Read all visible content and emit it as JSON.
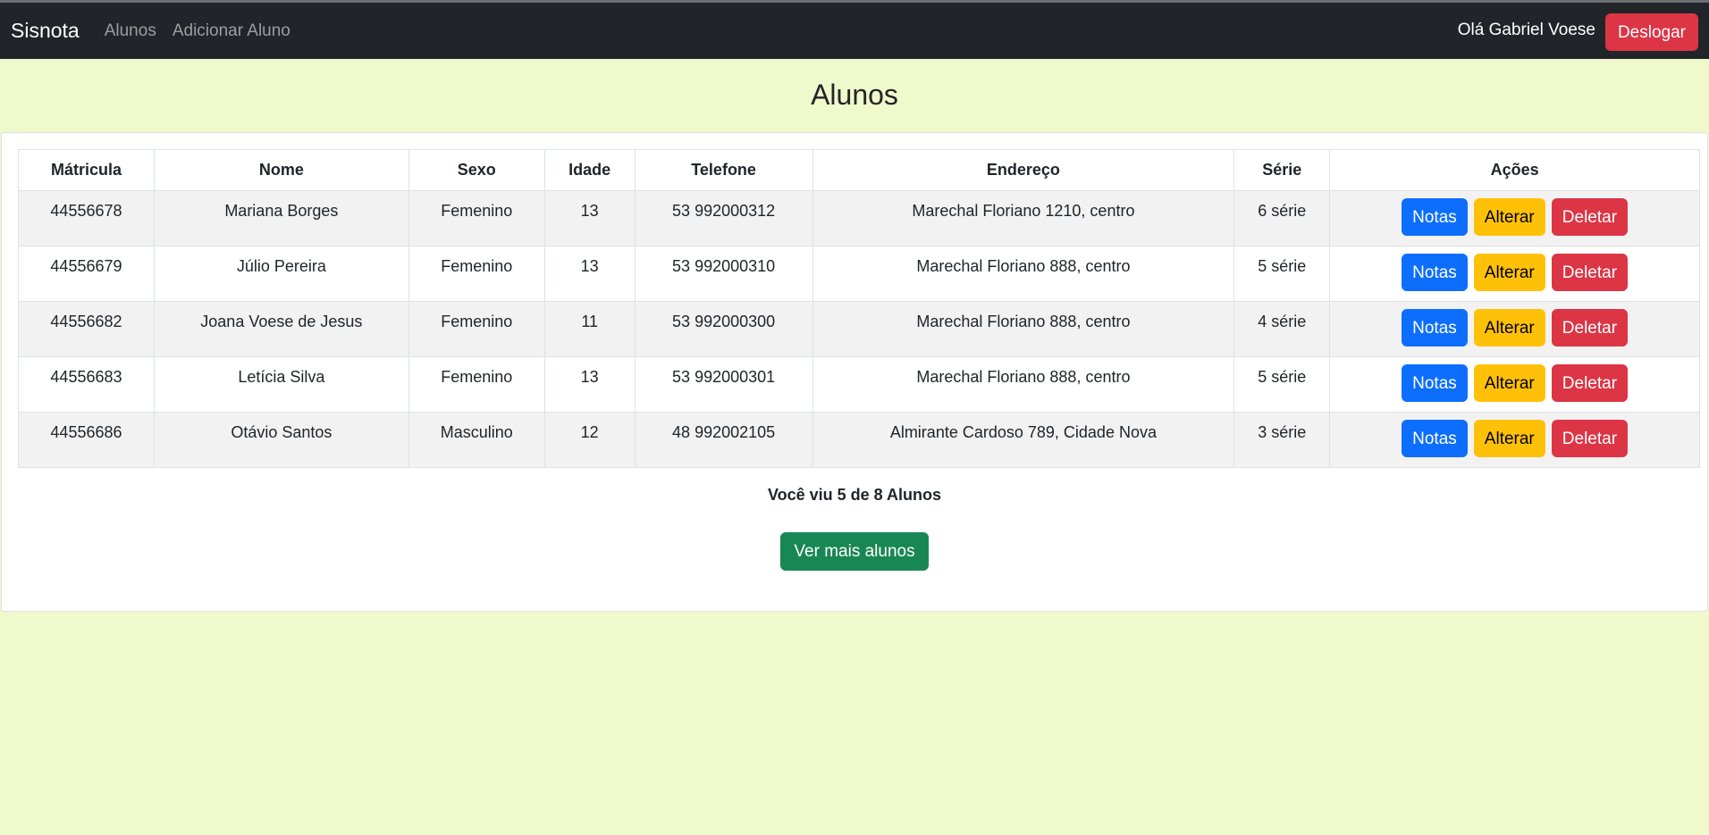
{
  "navbar": {
    "brand": "Sisnota",
    "links": [
      "Alunos",
      "Adicionar Aluno"
    ],
    "greeting": "Olá Gabriel Voese",
    "logout_label": "Deslogar"
  },
  "page": {
    "title": "Alunos"
  },
  "table": {
    "headers": [
      "Mátricula",
      "Nome",
      "Sexo",
      "Idade",
      "Telefone",
      "Endereço",
      "Série",
      "Ações"
    ],
    "rows": [
      {
        "matricula": "44556678",
        "nome": "Mariana Borges",
        "sexo": "Femenino",
        "idade": "13",
        "telefone": "53 992000312",
        "endereco": "Marechal Floriano 1210, centro",
        "serie": "6 série"
      },
      {
        "matricula": "44556679",
        "nome": "Júlio Pereira",
        "sexo": "Femenino",
        "idade": "13",
        "telefone": "53 992000310",
        "endereco": "Marechal Floriano 888, centro",
        "serie": "5 série"
      },
      {
        "matricula": "44556682",
        "nome": "Joana Voese de Jesus",
        "sexo": "Femenino",
        "idade": "11",
        "telefone": "53 992000300",
        "endereco": "Marechal Floriano 888, centro",
        "serie": "4 série"
      },
      {
        "matricula": "44556683",
        "nome": "Letícia Silva",
        "sexo": "Femenino",
        "idade": "13",
        "telefone": "53 992000301",
        "endereco": "Marechal Floriano 888, centro",
        "serie": "5 série"
      },
      {
        "matricula": "44556686",
        "nome": "Otávio Santos",
        "sexo": "Masculino",
        "idade": "12",
        "telefone": "48 992002105",
        "endereco": "Almirante Cardoso 789, Cidade Nova",
        "serie": "3 série"
      }
    ],
    "actions": {
      "notas": "Notas",
      "alterar": "Alterar",
      "deletar": "Deletar"
    }
  },
  "summary": "Você viu 5 de 8 Alunos",
  "more_button_label": "Ver mais alunos",
  "colors": {
    "navbar_bg": "#212529",
    "page_bg": "#f0f9cb",
    "primary": "#0d6efd",
    "warning": "#ffc107",
    "danger": "#dc3545",
    "success": "#198754"
  }
}
